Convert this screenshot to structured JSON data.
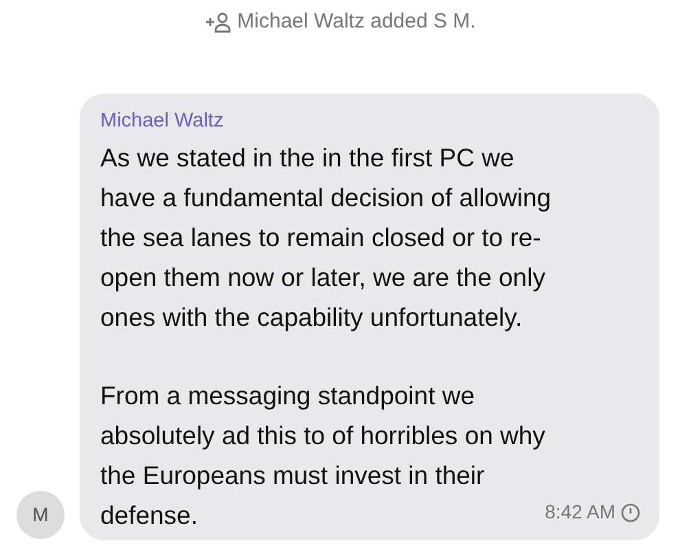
{
  "system_message": {
    "text": "Michael Waltz added S M."
  },
  "message": {
    "avatar_initial": "M",
    "sender": "Michael Waltz",
    "paragraphs": [
      [
        "As we stated in the in the first PC we",
        "have a fundamental decision of allowing",
        "the sea lanes to remain closed or to re-",
        "open them now or later, we are the only",
        "ones with the capability unfortunately."
      ],
      [
        "From a messaging standpoint we",
        "absolutely ad this to of horribles on why",
        "the Europeans must invest in their",
        "defense."
      ]
    ],
    "time": "8:42 AM"
  }
}
